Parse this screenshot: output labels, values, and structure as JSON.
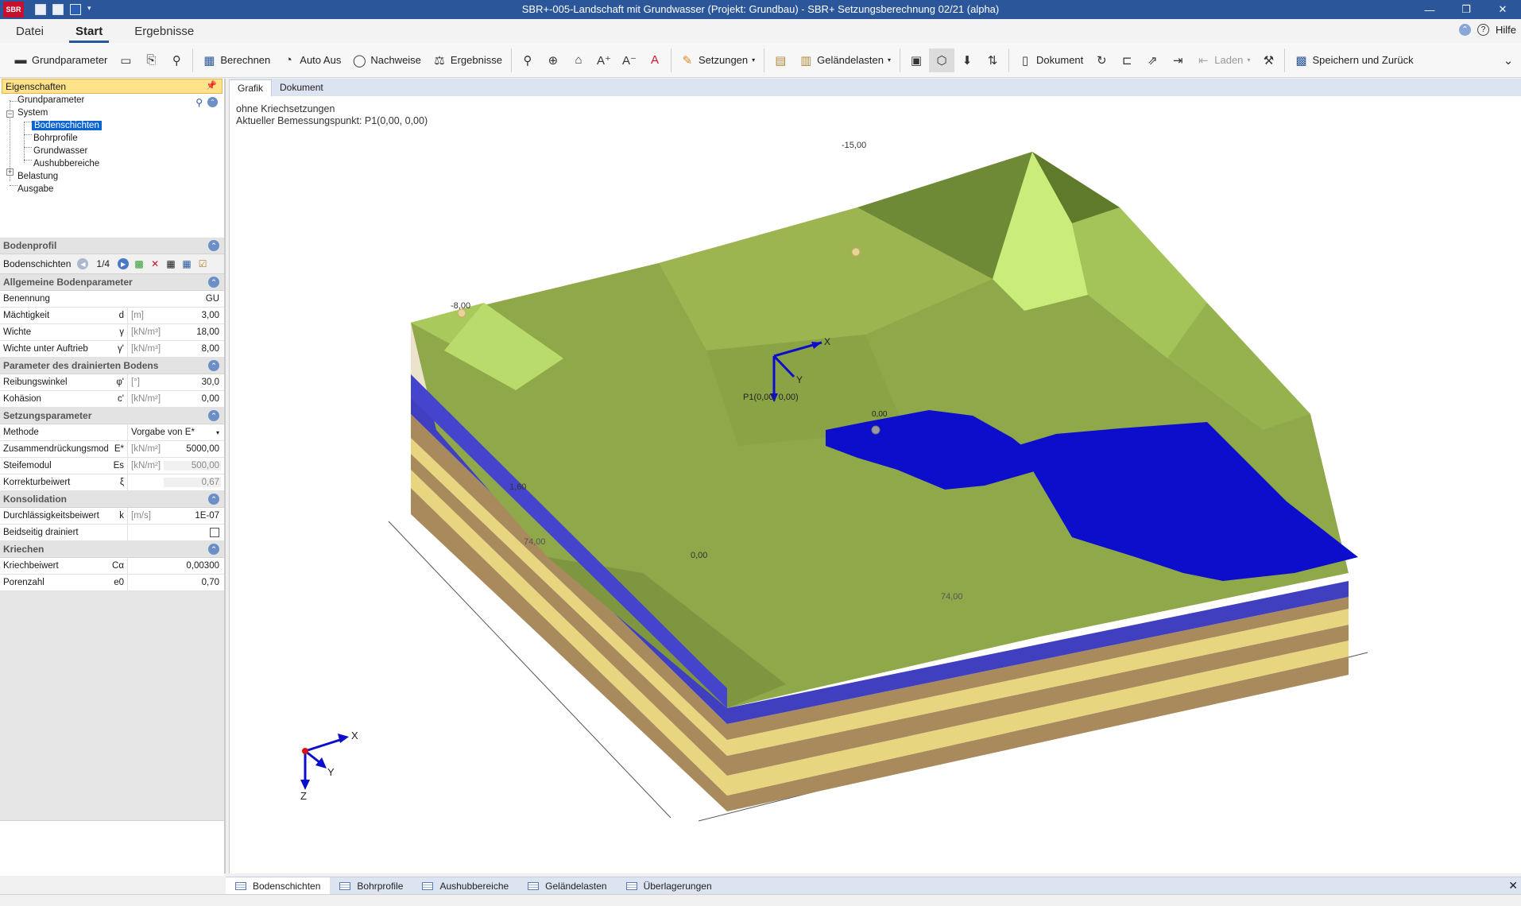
{
  "window": {
    "title": "SBR+-005-Landschaft mit Grundwasser (Projekt: Grundbau) - SBR+ Setzungsberechnung 02/21 (alpha)",
    "logo": "SBR",
    "min_label": "—",
    "max_label": "❐",
    "close_label": "✕"
  },
  "ribbon": {
    "tabs": [
      "Datei",
      "Start",
      "Ergebnisse"
    ],
    "active_tab": "Start",
    "help_label": "Hilfe"
  },
  "toolbar": {
    "grundparameter": "Grundparameter",
    "berechnen": "Berechnen",
    "auto_aus": "Auto Aus",
    "nachweise": "Nachweise",
    "ergebnisse": "Ergebnisse",
    "setzungen": "Setzungen",
    "gelaendelasten": "Geländelasten",
    "dokument": "Dokument",
    "laden": "Laden",
    "speichern": "Speichern und Zurück"
  },
  "properties_panel": {
    "title": "Eigenschaften",
    "tree": {
      "grundparameter": "Grundparameter",
      "system": "System",
      "bodenschichten": "Bodenschichten",
      "bohrprofile": "Bohrprofile",
      "grundwasser": "Grundwasser",
      "aushubbereiche": "Aushubbereiche",
      "belastung": "Belastung",
      "ausgabe": "Ausgabe"
    },
    "bodenprofil_header": "Bodenprofil",
    "layer_nav": {
      "label": "Bodenschichten",
      "counter": "1/4"
    },
    "sections": {
      "allgemeine": {
        "title": "Allgemeine Bodenparameter",
        "rows": [
          {
            "label": "Benennung",
            "symbol": "",
            "unit": "",
            "value": "GU"
          },
          {
            "label": "Mächtigkeit",
            "symbol": "d",
            "unit": "[m]",
            "value": "3,00"
          },
          {
            "label": "Wichte",
            "symbol": "γ",
            "unit": "[kN/m³]",
            "value": "18,00"
          },
          {
            "label": "Wichte unter Auftrieb",
            "symbol": "γ'",
            "unit": "[kN/m³]",
            "value": "8,00"
          }
        ]
      },
      "drainiert": {
        "title": "Parameter des drainierten Bodens",
        "rows": [
          {
            "label": "Reibungswinkel",
            "symbol": "φ'",
            "unit": "[°]",
            "value": "30,0"
          },
          {
            "label": "Kohäsion",
            "symbol": "c'",
            "unit": "[kN/m²]",
            "value": "0,00"
          }
        ]
      },
      "setzung": {
        "title": "Setzungsparameter",
        "methode_label": "Methode",
        "methode_value": "Vorgabe von E*",
        "rows": [
          {
            "label": "Zusammendrückungsmodul",
            "symbol": "E*",
            "unit": "[kN/m²]",
            "value": "5000,00"
          },
          {
            "label": "Steifemodul",
            "symbol": "Es",
            "unit": "[kN/m²]",
            "value": "500,00"
          },
          {
            "label": "Korrekturbeiwert",
            "symbol": "ξ",
            "unit": "",
            "value": "0,67"
          }
        ]
      },
      "konsolidation": {
        "title": "Konsolidation",
        "rows": [
          {
            "label": "Durchlässigkeitsbeiwert",
            "symbol": "k",
            "unit": "[m/s]",
            "value": "1E-07"
          }
        ],
        "beidseitig_label": "Beidseitig drainiert"
      },
      "kriechen": {
        "title": "Kriechen",
        "rows": [
          {
            "label": "Kriechbeiwert",
            "symbol": "Cα",
            "unit": "",
            "value": "0,00300"
          },
          {
            "label": "Porenzahl",
            "symbol": "e0",
            "unit": "",
            "value": "0,70"
          }
        ]
      }
    }
  },
  "content_tabs": [
    "Grafik",
    "Dokument"
  ],
  "graphic": {
    "line1": "ohne Kriechsetzungen",
    "line2": "Aktueller Bemessungspunkt: P1(0,00, 0,00)",
    "label_peak": "-15,00",
    "label_left": "-8,00",
    "label_160": "1,60",
    "label_000": "0,00",
    "label_dim_left": "74,00",
    "label_dim_right": "74,00",
    "label_point": "P1(0,00, 0,00)",
    "label_pond": "0,00",
    "axis_x": "X",
    "axis_y": "Y",
    "axis_z": "Z",
    "colors": {
      "terrain": "#8fa84a",
      "terrain_light": "#c9ec7a",
      "water": "#0d0dcc",
      "layer_sand": "#e8d580",
      "layer_brown": "#a88a5c"
    }
  },
  "bottom_tabs": [
    "Bodenschichten",
    "Bohrprofile",
    "Aushubbereiche",
    "Geländelasten",
    "Überlagerungen"
  ]
}
